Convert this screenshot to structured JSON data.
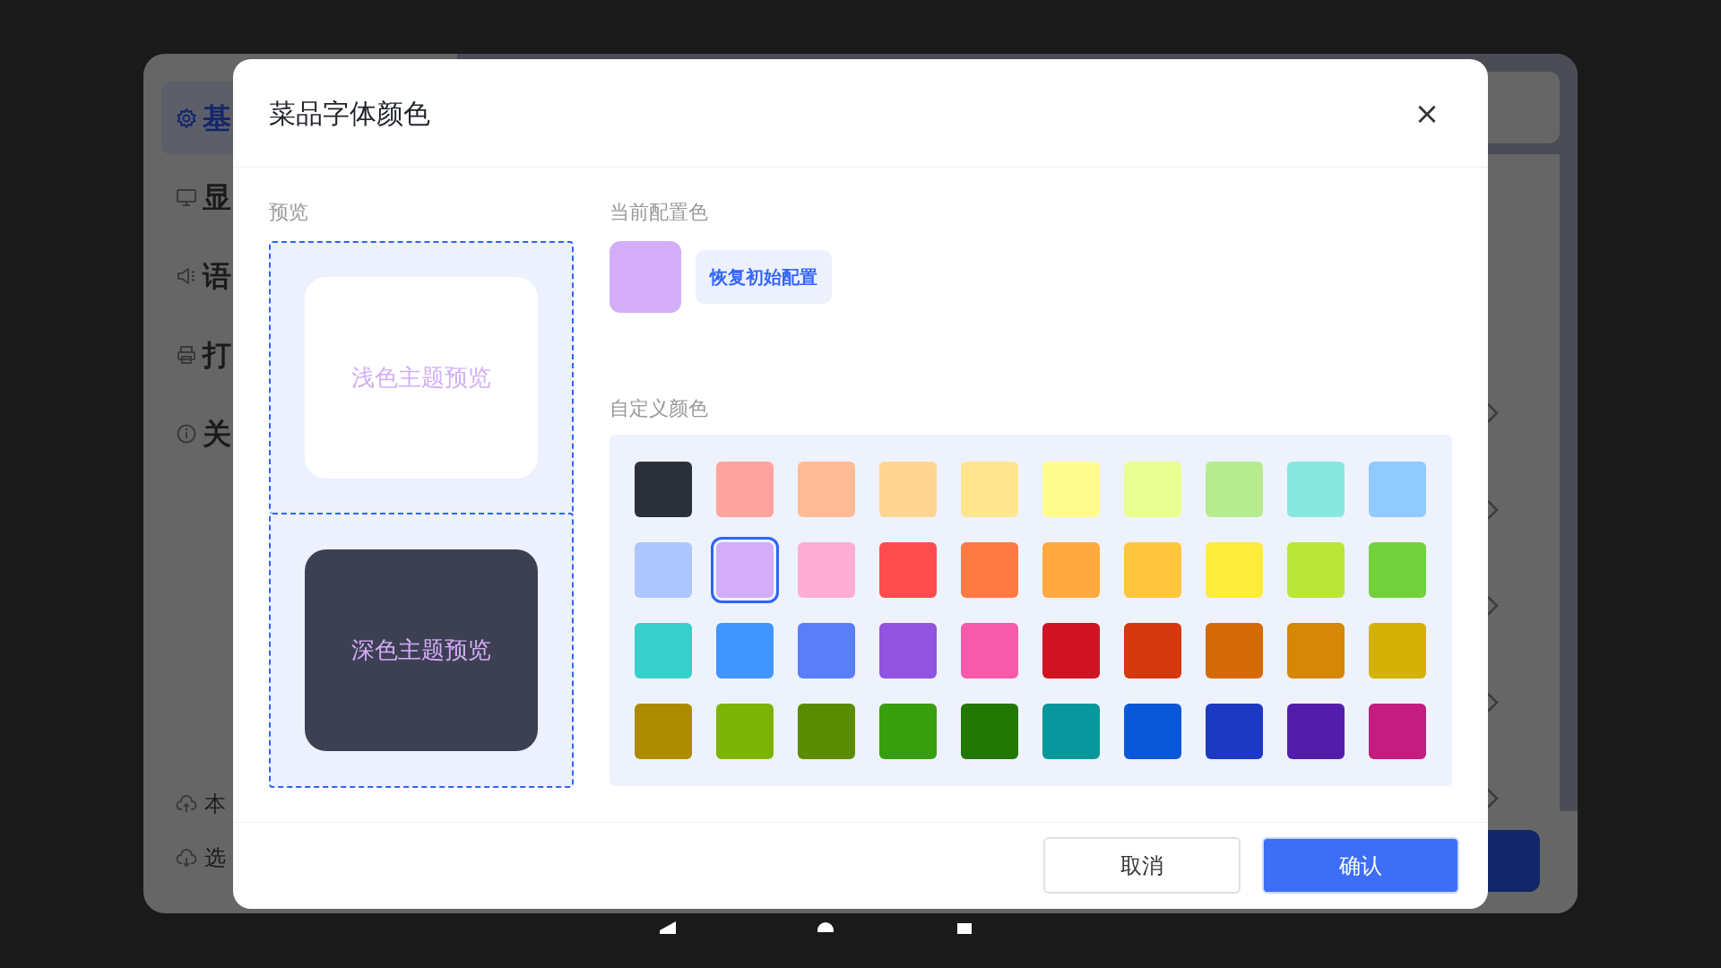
{
  "background_app": {
    "sidebar": {
      "items": [
        {
          "label": "基",
          "selected": true
        },
        {
          "label": "显",
          "selected": false
        },
        {
          "label": "语",
          "selected": false
        },
        {
          "label": "打",
          "selected": false
        },
        {
          "label": "关",
          "selected": false
        }
      ],
      "bottom_items": [
        {
          "label": "本"
        },
        {
          "label": "选"
        }
      ]
    }
  },
  "dialog": {
    "title": "菜品字体颜色",
    "close": "×",
    "preview": {
      "label": "预览",
      "light_text": "浅色主题预览",
      "dark_text": "深色主题预览"
    },
    "current": {
      "label": "当前配置色",
      "color": "#d3adf7",
      "reset_button": "恢复初始配置"
    },
    "custom": {
      "label": "自定义颜色",
      "swatches": [
        {
          "color": "#2c303a",
          "selected": false
        },
        {
          "color": "#ffa39e",
          "selected": false
        },
        {
          "color": "#ffbb96",
          "selected": false
        },
        {
          "color": "#ffd591",
          "selected": false
        },
        {
          "color": "#ffe58f",
          "selected": false
        },
        {
          "color": "#fffb8f",
          "selected": false
        },
        {
          "color": "#eaff8f",
          "selected": false
        },
        {
          "color": "#b7eb8f",
          "selected": false
        },
        {
          "color": "#87e8de",
          "selected": false
        },
        {
          "color": "#91caff",
          "selected": false
        },
        {
          "color": "#adc6ff",
          "selected": false
        },
        {
          "color": "#d3adf7",
          "selected": true
        },
        {
          "color": "#ffadd2",
          "selected": false
        },
        {
          "color": "#ff4d4f",
          "selected": false
        },
        {
          "color": "#ff7a45",
          "selected": false
        },
        {
          "color": "#ffa940",
          "selected": false
        },
        {
          "color": "#ffc53d",
          "selected": false
        },
        {
          "color": "#ffec3d",
          "selected": false
        },
        {
          "color": "#bae637",
          "selected": false
        },
        {
          "color": "#73d13d",
          "selected": false
        },
        {
          "color": "#36cfc9",
          "selected": false
        },
        {
          "color": "#4096ff",
          "selected": false
        },
        {
          "color": "#597ef7",
          "selected": false
        },
        {
          "color": "#9254de",
          "selected": false
        },
        {
          "color": "#f759ab",
          "selected": false
        },
        {
          "color": "#cf1322",
          "selected": false
        },
        {
          "color": "#d4380d",
          "selected": false
        },
        {
          "color": "#d46b08",
          "selected": false
        },
        {
          "color": "#d48806",
          "selected": false
        },
        {
          "color": "#d4b106",
          "selected": false
        },
        {
          "color": "#ad8b00",
          "selected": false
        },
        {
          "color": "#7cb305",
          "selected": false
        },
        {
          "color": "#5b8c00",
          "selected": false
        },
        {
          "color": "#389e0d",
          "selected": false
        },
        {
          "color": "#237804",
          "selected": false
        },
        {
          "color": "#08979c",
          "selected": false
        },
        {
          "color": "#0958d9",
          "selected": false
        },
        {
          "color": "#1d39c4",
          "selected": false
        },
        {
          "color": "#531dab",
          "selected": false
        },
        {
          "color": "#c41d7f",
          "selected": false
        }
      ]
    },
    "buttons": {
      "cancel": "取消",
      "confirm": "确认"
    }
  }
}
